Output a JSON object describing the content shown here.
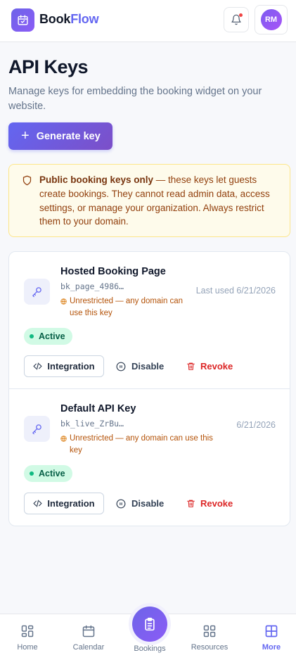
{
  "header": {
    "brand_part1": "Book",
    "brand_part2": "Flow",
    "avatar_initials": "RM",
    "brand_color": "#6366f1",
    "notification_color": "#ef4444"
  },
  "page": {
    "title": "API Keys",
    "description": "Manage keys for embedding the booking widget on your website.",
    "generate_button_label": "Generate key",
    "generate_button_icon": "plus-icon"
  },
  "notice": {
    "icon": "shield-icon",
    "bold": "Public booking keys only",
    "text": " — these keys let guests create bookings. They cannot read admin data, access settings, or manage your organization. Always restrict them to your domain."
  },
  "keys": [
    {
      "name": "Hosted Booking Page",
      "code": "bk_page_4986…",
      "warning": "Unrestricted — any domain can use this key",
      "last_used": "Last used 6/21/2026",
      "status": "Active",
      "actions": {
        "integration": "Integration",
        "disable": "Disable",
        "revoke": "Revoke"
      }
    },
    {
      "name": "Default API Key",
      "code": "bk_live_ZrBu…",
      "warning": "Unrestricted — any domain can use this key",
      "last_used": "6/21/2026",
      "status": "Active",
      "actions": {
        "integration": "Integration",
        "disable": "Disable",
        "revoke": "Revoke"
      }
    }
  ],
  "bottom_nav": {
    "items": [
      {
        "label": "Home",
        "icon": "home-grid-icon"
      },
      {
        "label": "Calendar",
        "icon": "calendar-icon"
      },
      {
        "label": "Bookings",
        "icon": "clipboard-icon"
      },
      {
        "label": "Resources",
        "icon": "resources-grid-icon"
      },
      {
        "label": "More",
        "icon": "more-grid-icon",
        "active": true
      }
    ]
  }
}
